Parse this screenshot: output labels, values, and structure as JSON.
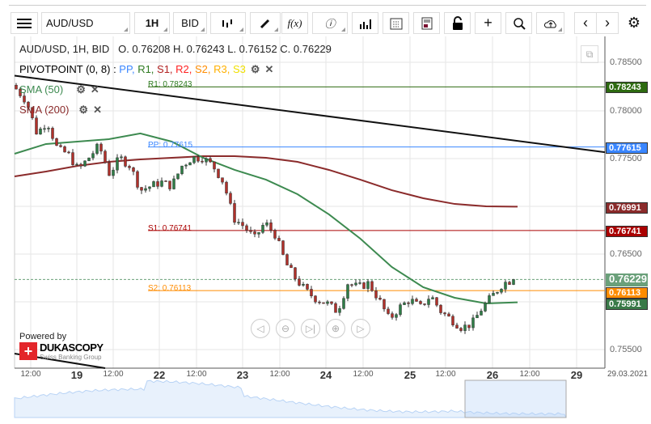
{
  "toolbar": {
    "instrument": "AUD/USD",
    "period": "1H",
    "side": "BID"
  },
  "header": {
    "summary": "AUD/USD, 1H, BID   O. 0.76208 H. 0.76243 L. 0.76152 C. 0.76229"
  },
  "indicators": {
    "pivot": {
      "name": "PIVOTPOINT (0, 8)",
      "sep": " : ",
      "levels": [
        {
          "t": "PP",
          "c": "#3a86ff"
        },
        {
          "t": "R1",
          "c": "#2d7a1f"
        },
        {
          "t": "S1",
          "c": "#b22222"
        },
        {
          "t": "R2",
          "c": "#ff2020"
        },
        {
          "t": "S2",
          "c": "#ff8c00"
        },
        {
          "t": "R3",
          "c": "#ffb000"
        },
        {
          "t": "S3",
          "c": "#f0e000"
        }
      ]
    },
    "sma50": {
      "name": "SMA (50)",
      "color": "#3d8a50"
    },
    "sma200": {
      "name": "SMA (200)",
      "color": "#8b2b2b"
    }
  },
  "lines": {
    "r1": "R1: 0.78243",
    "pp": "PP: 0.77615",
    "s1": "S1: 0.76741",
    "s2": "S2: 0.76113"
  },
  "price_labels": {
    "r1": "0.78243",
    "pp": "0.77615",
    "sma200": "0.76991",
    "s1": "0.76741",
    "last": "0.76229",
    "s2": "0.76113",
    "sma50": "0.75991"
  },
  "y_axis": [
    "0.78500",
    "0.78000",
    "0.77500",
    "0.76500",
    "0.75500"
  ],
  "x_axis": [
    {
      "t": "12:00",
      "b": false
    },
    {
      "t": "19",
      "b": true
    },
    {
      "t": "12:00",
      "b": false
    },
    {
      "t": "22",
      "b": true
    },
    {
      "t": "12:00",
      "b": false
    },
    {
      "t": "23",
      "b": true
    },
    {
      "t": "12:00",
      "b": false
    },
    {
      "t": "24",
      "b": true
    },
    {
      "t": "12:00",
      "b": false
    },
    {
      "t": "25",
      "b": true
    },
    {
      "t": "12:00",
      "b": false
    },
    {
      "t": "26",
      "b": true
    },
    {
      "t": "12:00",
      "b": false
    },
    {
      "t": "29",
      "b": true
    },
    {
      "t": "29.03.2021",
      "b": false
    }
  ],
  "logo": {
    "powered": "Powered by",
    "brand": "DUKASCOPY",
    "tag": "Swiss Banking Group"
  },
  "chart_data": {
    "type": "candlestick",
    "levels": {
      "r1": 0.78243,
      "pp": 0.77615,
      "s1": 0.76741,
      "s2": 0.76113,
      "last": 0.76229
    },
    "closes": [
      0.78221,
      0.78094,
      0.77756,
      0.77882,
      0.77586,
      0.77544,
      0.77375,
      0.77502,
      0.77629,
      0.77332,
      0.77502,
      0.77417,
      0.77163,
      0.77206,
      0.77248,
      0.77206,
      0.77417,
      0.77502,
      0.77502,
      0.77417,
      0.77248,
      0.76867,
      0.76783,
      0.76656,
      0.76825,
      0.76698,
      0.76402,
      0.76233,
      0.76106,
      0.76021,
      0.75979,
      0.75894,
      0.7619,
      0.76148,
      0.7619,
      0.76021,
      0.7581,
      0.75937,
      0.76021,
      0.75937,
      0.76063,
      0.75894,
      0.7581,
      0.75725,
      0.75767,
      0.75937,
      0.76063,
      0.7619,
      0.76229
    ],
    "sma50": [
      0.77544,
      0.77646,
      0.77671,
      0.77696,
      0.77756,
      0.77671,
      0.77502,
      0.77375,
      0.77273,
      0.77121,
      0.7691,
      0.76656,
      0.7636,
      0.76148,
      0.76038,
      0.75979,
      0.75991
    ],
    "sma200": [
      0.77307,
      0.77358,
      0.77417,
      0.77459,
      0.77485,
      0.77502,
      0.77519,
      0.77519,
      0.77502,
      0.77459,
      0.77375,
      0.77273,
      0.77163,
      0.77079,
      0.77019,
      0.76994,
      0.76991
    ],
    "trendline": [
      0.7836,
      0.7756
    ],
    "ylim": [
      0.752,
      0.788
    ]
  }
}
